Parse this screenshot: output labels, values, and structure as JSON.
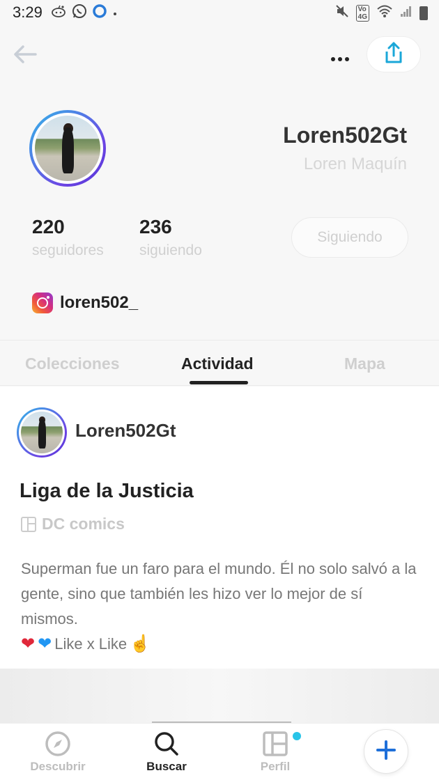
{
  "status_bar": {
    "time": "3:29",
    "icons": [
      "reddit-icon",
      "whatsapp-icon",
      "circle-app-icon",
      "dot-icon",
      "mute-icon",
      "volte-icon",
      "wifi-icon",
      "signal-icon",
      "battery-icon"
    ],
    "volte_text": "Vo) 4G"
  },
  "header": {
    "back_icon": "arrow-left-icon",
    "more_icon": "more-horizontal-icon",
    "share_icon": "share-icon"
  },
  "profile": {
    "username": "Loren502Gt",
    "real_name": "Loren Maquín",
    "followers_count": "220",
    "followers_label": "seguidores",
    "following_count": "236",
    "following_label": "siguiendo",
    "follow_button_label": "Siguiendo",
    "instagram_handle": "loren502_"
  },
  "tabs": [
    {
      "label": "Colecciones",
      "active": false
    },
    {
      "label": "Actividad",
      "active": true
    },
    {
      "label": "Mapa",
      "active": false
    }
  ],
  "activity": {
    "username": "Loren502Gt",
    "title": "Liga de la Justicia",
    "collection": "DC comics",
    "text": "Superman fue un faro para el mundo. Él no solo salvó a la gente, sino que también les hizo ver lo mejor de sí mismos.",
    "like_text": "Like x Like"
  },
  "bottom_nav": {
    "discover": "Descubrir",
    "search": "Buscar",
    "profile": "Perfil"
  },
  "colors": {
    "accent_blue": "#29c4e8",
    "avatar_gradient_start": "#33b7e8",
    "avatar_gradient_end": "#5236d6",
    "add_button": "#1e6fd9"
  }
}
